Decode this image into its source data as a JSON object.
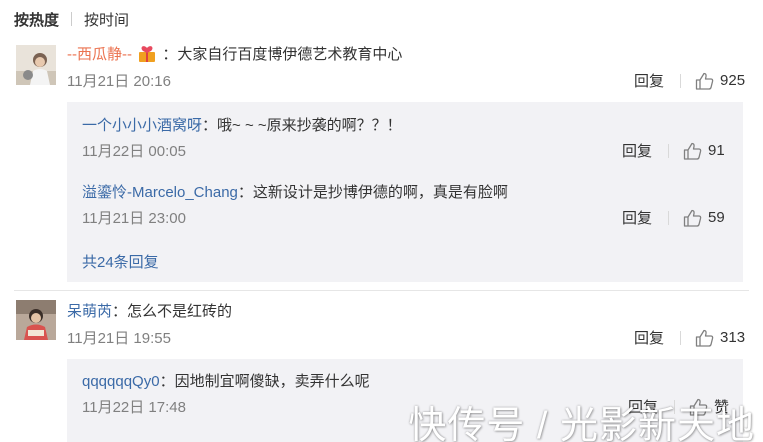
{
  "sort": {
    "hot": "按热度",
    "time": "按时间"
  },
  "actions": {
    "reply": "回复",
    "like_word": "赞"
  },
  "comments": [
    {
      "user": "--西瓜静--",
      "text": "：大家自行百度博伊德艺术教育中心",
      "time": "11月21日 20:16",
      "likes": "925",
      "replies": [
        {
          "user": "一个小小小酒窝呀",
          "text": "：哦~ ~ ~原来抄袭的啊？？！",
          "time": "11月22日 00:05",
          "likes": "91"
        },
        {
          "user": "溢鎏怜-Marcelo_Chang",
          "text": "：这新设计是抄博伊德的啊，真是有脸啊",
          "time": "11月21日 23:00",
          "likes": "59"
        }
      ],
      "more": "共24条回复"
    },
    {
      "user": "呆萌芮",
      "text": "：怎么不是红砖的",
      "time": "11月21日 19:55",
      "likes": "313",
      "replies": [
        {
          "user": "qqqqqqQy0",
          "text": "：因地制宜啊傻缺，卖弄什么呢",
          "time": "11月22日 17:48"
        }
      ]
    }
  ],
  "watermark": "快传号 / 光影新天地"
}
